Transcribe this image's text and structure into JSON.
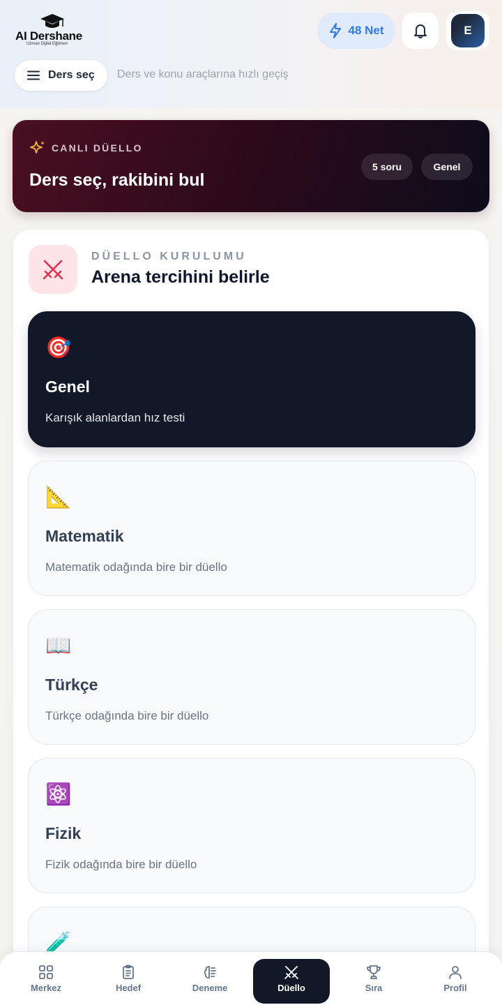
{
  "header": {
    "brand": "AI Dershane",
    "tagline": "Uzman Dijital Eğitmen",
    "net_label": "48 Net",
    "avatar_initial": "E",
    "ders_button_label": "Ders seç",
    "ders_hint": "Ders ve konu araçlarına hızlı geçiş"
  },
  "banner": {
    "kicker": "CANLI DÜELLO",
    "headline": "Ders seç, rakibini bul",
    "chips": [
      "5 soru",
      "Genel"
    ]
  },
  "setup": {
    "kicker": "DÜELLO KURULUMU",
    "title": "Arena tercihini belirle",
    "options": [
      {
        "emoji": "🎯",
        "name": "Genel",
        "desc": "Karışık alanlardan hız testi",
        "selected": true
      },
      {
        "emoji": "📐",
        "name": "Matematik",
        "desc": "Matematik odağında bire bir düello",
        "selected": false
      },
      {
        "emoji": "📖",
        "name": "Türkçe",
        "desc": "Türkçe odağında bire bir düello",
        "selected": false
      },
      {
        "emoji": "⚛️",
        "name": "Fizik",
        "desc": "Fizik odağında bire bir düello",
        "selected": false
      },
      {
        "emoji": "🧪",
        "name": "",
        "desc": "",
        "selected": false
      }
    ]
  },
  "nav": {
    "items": [
      {
        "label": "Merkez",
        "icon": "grid-icon"
      },
      {
        "label": "Hedef",
        "icon": "clipboard-icon"
      },
      {
        "label": "Deneme",
        "icon": "brain-icon"
      },
      {
        "label": "Düello",
        "icon": "swords-icon",
        "active": true
      },
      {
        "label": "Sıra",
        "icon": "trophy-icon"
      },
      {
        "label": "Profil",
        "icon": "user-icon"
      }
    ]
  },
  "colors": {
    "accent_blue": "#2f7be8",
    "dark": "#111827",
    "banner_start": "#4a0f22",
    "duel_red": "#e0324f"
  }
}
